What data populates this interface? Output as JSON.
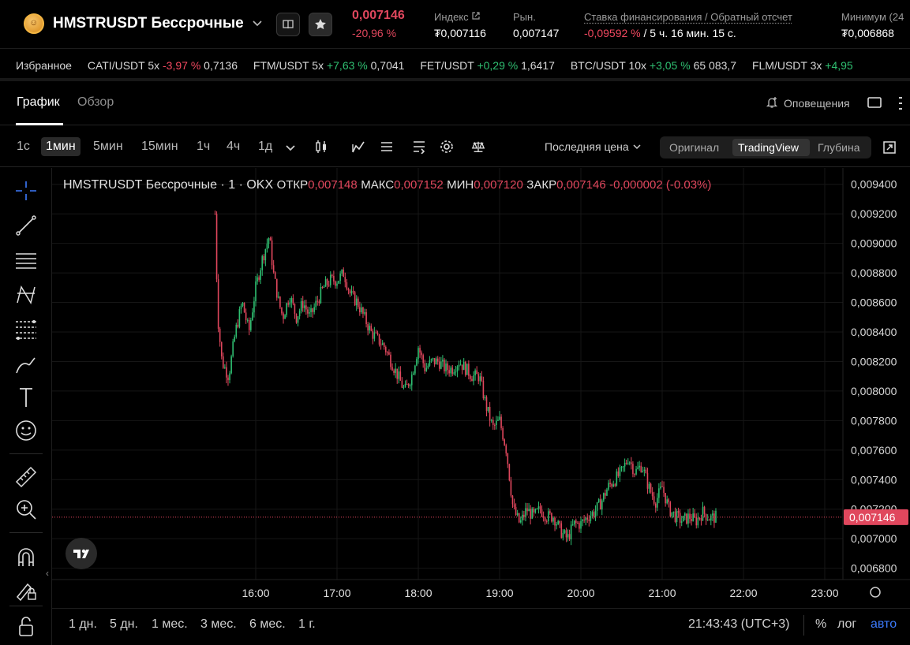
{
  "header": {
    "coin_glyph": "☺",
    "symbol": "HMSTRUSDT Бессрочные",
    "last_price": "0,007146",
    "change_pct": "-20,96 %",
    "index_label": "Индекс",
    "index_value": "₮0,007116",
    "market_label": "Рын.",
    "market_value": "0,007147",
    "funding_label": "Ставка финансирования / Обратный отсчет",
    "funding_rate": "-0,09592 %",
    "funding_countdown": " / 5 ч. 16 мин. 15 с.",
    "min_label": "Минимум (24",
    "min_value": "₮0,006868"
  },
  "ticker": {
    "favorites_label": "Избранное",
    "items": [
      {
        "name": "CATI/USDT 5x",
        "change": "-3,97 %",
        "price": "0,7136",
        "dir": "neg"
      },
      {
        "name": "FTM/USDT 5x",
        "change": "+7,63 %",
        "price": "0,7041",
        "dir": "pos"
      },
      {
        "name": "FET/USDT",
        "change": "+0,29 %",
        "price": "1,6417",
        "dir": "pos"
      },
      {
        "name": "BTC/USDT 10x",
        "change": "+3,05 %",
        "price": "65 083,7",
        "dir": "pos"
      },
      {
        "name": "FLM/USDT 3x",
        "change": "+4,95",
        "price": "",
        "dir": "pos"
      }
    ]
  },
  "tabs": {
    "chart": "График",
    "overview": "Обзор",
    "alerts": "Оповещения"
  },
  "toolbar": {
    "timeframes": [
      "1с",
      "1мин",
      "5мин",
      "15мин",
      "1ч",
      "4ч",
      "1д"
    ],
    "active_timeframe": "1мин",
    "price_source": "Последняя цена",
    "views": [
      "Оригинал",
      "TradingView",
      "Глубина"
    ],
    "active_view": "TradingView"
  },
  "legend": {
    "title": "HMSTRUSDT Бессрочные · 1 · OKX",
    "open_label": "ОТКР",
    "open": "0,007148",
    "high_label": "МАКС",
    "high": "0,007152",
    "low_label": "МИН",
    "low": "0,007120",
    "close_label": "ЗАКР",
    "close": "0,007146",
    "change": "-0,000002 (-0.03%)"
  },
  "bottom": {
    "ranges": [
      "1 дн.",
      "5 дн.",
      "1 мес.",
      "3 мес.",
      "6 мес.",
      "1 г."
    ],
    "clock": "21:43:43 (UTC+3)",
    "pct": "%",
    "log": "лог",
    "auto": "авто"
  },
  "colors": {
    "up": "#2fbf71",
    "down": "#e0475d",
    "accent": "#3d7bfd"
  },
  "chart_data": {
    "type": "candlestick",
    "title": "HMSTRUSDT Бессрочные · 1 · OKX",
    "x_ticks": [
      "16:00",
      "17:00",
      "18:00",
      "19:00",
      "20:00",
      "21:00",
      "22:00",
      "23:00"
    ],
    "y_ticks": [
      "0,009400",
      "0,009200",
      "0,009000",
      "0,008800",
      "0,008600",
      "0,008400",
      "0,008200",
      "0,008000",
      "0,007800",
      "0,007600",
      "0,007400",
      "0,007200",
      "0,007000",
      "0,006800"
    ],
    "ylim": [
      0.00675,
      0.00942
    ],
    "current_price": 0.007146,
    "current_price_label": "0,007146",
    "price_path": [
      [
        "15:30",
        0.0092
      ],
      [
        "15:32",
        0.0085
      ],
      [
        "15:35",
        0.0082
      ],
      [
        "15:40",
        0.0081
      ],
      [
        "15:45",
        0.0084
      ],
      [
        "15:50",
        0.0086
      ],
      [
        "15:55",
        0.0084
      ],
      [
        "16:00",
        0.0087
      ],
      [
        "16:05",
        0.0089
      ],
      [
        "16:10",
        0.00905
      ],
      [
        "16:13",
        0.0088
      ],
      [
        "16:17",
        0.0086
      ],
      [
        "16:20",
        0.0085
      ],
      [
        "16:25",
        0.00865
      ],
      [
        "16:30",
        0.0085
      ],
      [
        "16:35",
        0.0086
      ],
      [
        "16:40",
        0.0085
      ],
      [
        "16:45",
        0.0086
      ],
      [
        "16:50",
        0.0087
      ],
      [
        "16:55",
        0.00875
      ],
      [
        "17:00",
        0.00875
      ],
      [
        "17:05",
        0.0088
      ],
      [
        "17:10",
        0.00865
      ],
      [
        "17:15",
        0.0086
      ],
      [
        "17:20",
        0.0085
      ],
      [
        "17:25",
        0.0084
      ],
      [
        "17:30",
        0.00835
      ],
      [
        "17:35",
        0.0083
      ],
      [
        "17:40",
        0.0082
      ],
      [
        "17:45",
        0.0081
      ],
      [
        "17:50",
        0.008
      ],
      [
        "17:55",
        0.0081
      ],
      [
        "18:00",
        0.0083
      ],
      [
        "18:05",
        0.00815
      ],
      [
        "18:10",
        0.0082
      ],
      [
        "18:15",
        0.0082
      ],
      [
        "18:20",
        0.00815
      ],
      [
        "18:25",
        0.00815
      ],
      [
        "18:30",
        0.0082
      ],
      [
        "18:35",
        0.00815
      ],
      [
        "18:40",
        0.0081
      ],
      [
        "18:45",
        0.0081
      ],
      [
        "18:50",
        0.0079
      ],
      [
        "18:55",
        0.00775
      ],
      [
        "19:00",
        0.0078
      ],
      [
        "19:05",
        0.0076
      ],
      [
        "19:10",
        0.0072
      ],
      [
        "19:15",
        0.0071
      ],
      [
        "19:20",
        0.0072
      ],
      [
        "19:25",
        0.00715
      ],
      [
        "19:30",
        0.0072
      ],
      [
        "19:35",
        0.00715
      ],
      [
        "19:40",
        0.00715
      ],
      [
        "19:45",
        0.00705
      ],
      [
        "19:50",
        0.007
      ],
      [
        "19:55",
        0.0071
      ],
      [
        "20:00",
        0.0071
      ],
      [
        "20:05",
        0.00715
      ],
      [
        "20:10",
        0.00718
      ],
      [
        "20:15",
        0.00725
      ],
      [
        "20:20",
        0.00735
      ],
      [
        "20:25",
        0.0074
      ],
      [
        "20:30",
        0.00745
      ],
      [
        "20:35",
        0.00755
      ],
      [
        "20:40",
        0.00745
      ],
      [
        "20:45",
        0.0075
      ],
      [
        "20:50",
        0.00735
      ],
      [
        "20:55",
        0.00725
      ],
      [
        "21:00",
        0.00735
      ],
      [
        "21:05",
        0.0072
      ],
      [
        "21:10",
        0.00715
      ],
      [
        "21:15",
        0.00712
      ],
      [
        "21:20",
        0.00715
      ],
      [
        "21:25",
        0.00712
      ],
      [
        "21:30",
        0.00718
      ],
      [
        "21:35",
        0.00714
      ],
      [
        "21:40",
        0.007146
      ]
    ]
  }
}
